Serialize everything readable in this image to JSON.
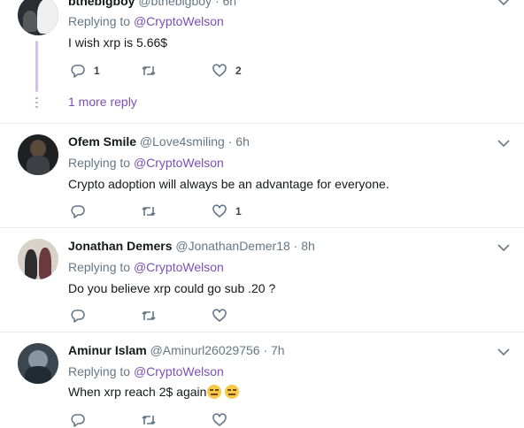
{
  "tweets": [
    {
      "name": "bthebigboy",
      "handle": "@bthebigboy",
      "time": "· 6h",
      "replying_prefix": "Replying to ",
      "replying_mention": "@CryptoWelson",
      "text": "I wish xrp is 5.66$",
      "reply_count": "1",
      "retweet_count": "",
      "like_count": "2",
      "more_replies": "1 more reply"
    },
    {
      "name": "Ofem Smile",
      "handle": "@Love4smiling",
      "time": "· 6h",
      "replying_prefix": "Replying to ",
      "replying_mention": "@CryptoWelson",
      "text": "Crypto adoption will always be an advantage for everyone.",
      "reply_count": "",
      "retweet_count": "",
      "like_count": "1"
    },
    {
      "name": "Jonathan Demers",
      "handle": "@JonathanDemer18",
      "time": "· 8h",
      "replying_prefix": "Replying to ",
      "replying_mention": "@CryptoWelson",
      "text": "Do you believe xrp could go sub .20 ?",
      "reply_count": "",
      "retweet_count": "",
      "like_count": ""
    },
    {
      "name": "Aminur Islam",
      "handle": "@Aminurl26029756",
      "time": "· 7h",
      "replying_prefix": "Replying to ",
      "replying_mention": "@CryptoWelson",
      "text": "When xrp reach 2$ again",
      "emoji": [
        "expressionless-face-emoji",
        "expressionless-face-emoji"
      ],
      "reply_count": "",
      "retweet_count": "",
      "like_count": ""
    }
  ],
  "colors": {
    "mention": "#7b4fb5",
    "thread_line": "#d4bfe6",
    "secondary_text": "#657786",
    "divider": "#e6ecf0"
  }
}
